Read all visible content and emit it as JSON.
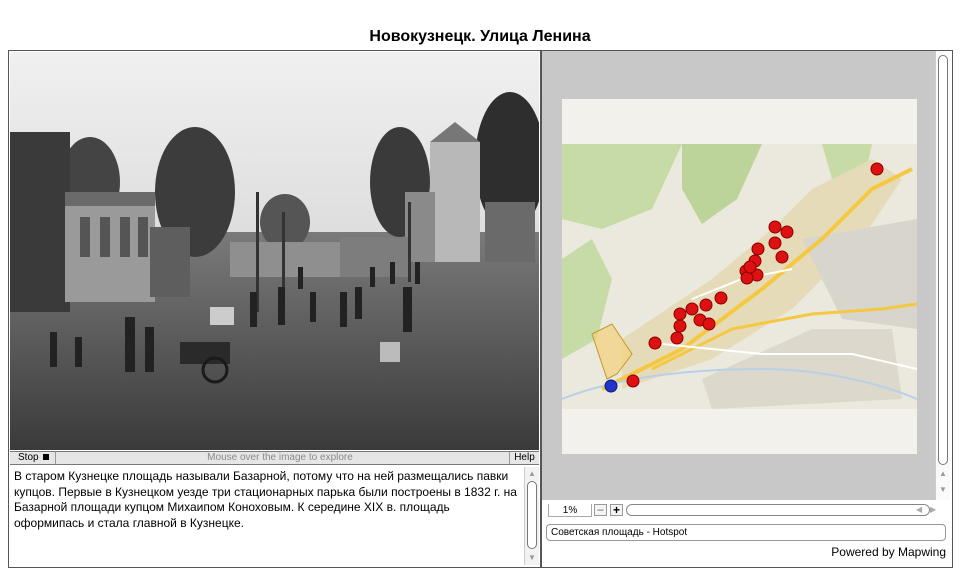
{
  "page": {
    "title": "Новокузнецк. Улица Ленина"
  },
  "photo_panel": {
    "stop_label": "Stop",
    "hint": "Mouse over the image to explore",
    "help_label": "Help",
    "description": "В старом Кузнецке площадь называли Базарной, потому что на ней размещались павки купцов. Первые в Кузнецком уезде три стационарных парька были построены в 1832 г. на Базарной площади купцом Михаипом Конохoвым. К середине XIX в. площадь оформипась и стала главной в Кузнецке."
  },
  "map_panel": {
    "zoom_value": "1%",
    "zoom_out": "−",
    "zoom_in": "+",
    "status_text": "Советская площадь - Hotspot",
    "powered_by": "Powered by Mapwing",
    "hotspot_count": 22,
    "colors": {
      "hotspot": "#dd1111",
      "current": "#2233cc",
      "road": "#f5c842",
      "park": "#c6dba5"
    }
  }
}
